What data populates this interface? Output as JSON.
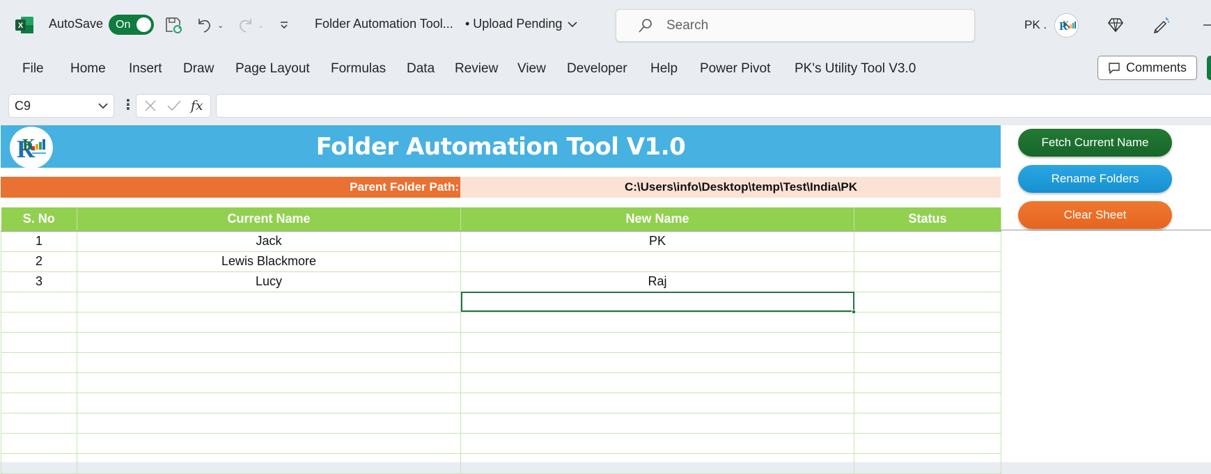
{
  "titlebar": {
    "app_icon": "excel-icon",
    "autosave_label": "AutoSave",
    "autosave_state": "On",
    "doc_title": "Folder Automation Tool...",
    "upload_status": "• Upload Pending",
    "search_placeholder": "Search",
    "user_name": "PK .",
    "icons": [
      "save-sync-icon",
      "undo-icon",
      "redo-icon",
      "customize-quick-access-icon",
      "diamond-icon",
      "coauthoring-icon",
      "minimize-icon"
    ]
  },
  "ribbon": {
    "tabs": [
      "File",
      "Home",
      "Insert",
      "Draw",
      "Page Layout",
      "Formulas",
      "Data",
      "Review",
      "View",
      "Developer",
      "Help",
      "Power Pivot",
      "PK's Utility Tool V3.0"
    ],
    "comments_label": "Comments"
  },
  "formula_bar": {
    "name_box": "C9",
    "fx_label": "fx",
    "formula": ""
  },
  "sheet": {
    "title": "Folder Automation Tool V1.0",
    "path_label": "Parent Folder Path:",
    "path_value": "C:\\Users\\info\\Desktop\\temp\\Test\\India\\PK",
    "columns": [
      "S. No",
      "Current Name",
      "New Name",
      "Status"
    ],
    "rows": [
      [
        "1",
        "Jack",
        "PK",
        ""
      ],
      [
        "2",
        "Lewis Blackmore",
        "",
        ""
      ],
      [
        "3",
        "Lucy",
        "Raj",
        ""
      ],
      [
        "",
        "",
        "",
        ""
      ],
      [
        "",
        "",
        "",
        ""
      ],
      [
        "",
        "",
        "",
        ""
      ],
      [
        "",
        "",
        "",
        ""
      ],
      [
        "",
        "",
        "",
        ""
      ],
      [
        "",
        "",
        "",
        ""
      ],
      [
        "",
        "",
        "",
        ""
      ],
      [
        "",
        "",
        "",
        ""
      ],
      [
        "",
        "",
        "",
        ""
      ]
    ],
    "selected_cell": "C9",
    "buttons": {
      "fetch": "Fetch Current Name",
      "rename": "Rename Folders",
      "clear": "Clear Sheet"
    }
  },
  "colors": {
    "banner": "#47b1e1",
    "path_label": "#e97132",
    "path_value": "#fbe2d5",
    "header": "#92d050",
    "fetch_button": "#1e7130",
    "rename_button": "#1f9ad8",
    "clear_button": "#ea6c25",
    "excel_green": "#0f7b3f"
  }
}
